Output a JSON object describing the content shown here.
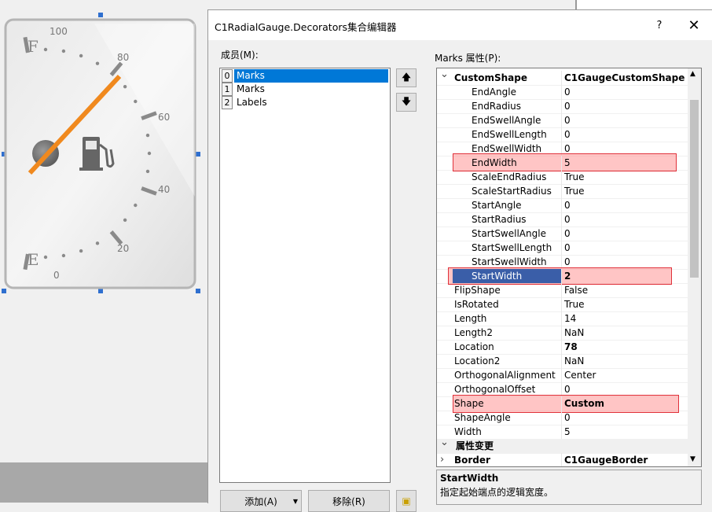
{
  "dialog": {
    "title": "C1RadialGauge.Decorators集合编辑器",
    "help": "?",
    "close": "✕",
    "members_label": "成员(M):",
    "props_label": "Marks 属性(P):"
  },
  "gauge": {
    "letter_full": "F",
    "letter_empty": "E",
    "ticks": [
      "100",
      "80",
      "60",
      "40",
      "20",
      "0"
    ],
    "needle_color": "#f0891e",
    "icon": "fuel-pump-icon"
  },
  "members": [
    {
      "index": "0",
      "name": "Marks",
      "selected": true
    },
    {
      "index": "1",
      "name": "Marks",
      "selected": false
    },
    {
      "index": "2",
      "name": "Labels",
      "selected": false
    }
  ],
  "properties": [
    {
      "name": "CustomShape",
      "value": "C1GaugeCustomShape",
      "level": 0,
      "bold": true,
      "expander": "down"
    },
    {
      "name": "EndAngle",
      "value": "0",
      "level": 1
    },
    {
      "name": "EndRadius",
      "value": "0",
      "level": 1
    },
    {
      "name": "EndSwellAngle",
      "value": "0",
      "level": 1
    },
    {
      "name": "EndSwellLength",
      "value": "0",
      "level": 1
    },
    {
      "name": "EndSwellWidth",
      "value": "0",
      "level": 1
    },
    {
      "name": "EndWidth",
      "value": "5",
      "level": 1,
      "highlight": true
    },
    {
      "name": "ScaleEndRadius",
      "value": "True",
      "level": 1
    },
    {
      "name": "ScaleStartRadius",
      "value": "True",
      "level": 1
    },
    {
      "name": "StartAngle",
      "value": "0",
      "level": 1
    },
    {
      "name": "StartRadius",
      "value": "0",
      "level": 1
    },
    {
      "name": "StartSwellAngle",
      "value": "0",
      "level": 1
    },
    {
      "name": "StartSwellLength",
      "value": "0",
      "level": 1
    },
    {
      "name": "StartSwellWidth",
      "value": "0",
      "level": 1
    },
    {
      "name": "StartWidth",
      "value": "2",
      "level": 1,
      "highlight": true,
      "selected": true,
      "bold": true
    },
    {
      "name": "FlipShape",
      "value": "False",
      "level": 0
    },
    {
      "name": "IsRotated",
      "value": "True",
      "level": 0
    },
    {
      "name": "Length",
      "value": "14",
      "level": 0
    },
    {
      "name": "Length2",
      "value": "NaN",
      "level": 0
    },
    {
      "name": "Location",
      "value": "78",
      "level": 0,
      "bold": true
    },
    {
      "name": "Location2",
      "value": "NaN",
      "level": 0
    },
    {
      "name": "OrthogonalAlignment",
      "value": "Center",
      "level": 0
    },
    {
      "name": "OrthogonalOffset",
      "value": "0",
      "level": 0
    },
    {
      "name": "Shape",
      "value": "Custom",
      "level": 0,
      "bold": true,
      "highlight": true
    },
    {
      "name": "ShapeAngle",
      "value": "0",
      "level": 0
    },
    {
      "name": "Width",
      "value": "5",
      "level": 0
    },
    {
      "name": "属性变更",
      "value": "",
      "level": -1,
      "bold": true,
      "expander": "down",
      "category": true
    },
    {
      "name": "Border",
      "value": "C1GaugeBorder",
      "level": 0,
      "bold": true,
      "expander": "right"
    }
  ],
  "description": {
    "title": "StartWidth",
    "text": "指定起始端点的逻辑宽度。"
  },
  "buttons": {
    "add": "添加(A)",
    "remove": "移除(R)"
  },
  "colors": {
    "selection": "#0078d7",
    "highlight_border": "#e0313a"
  }
}
